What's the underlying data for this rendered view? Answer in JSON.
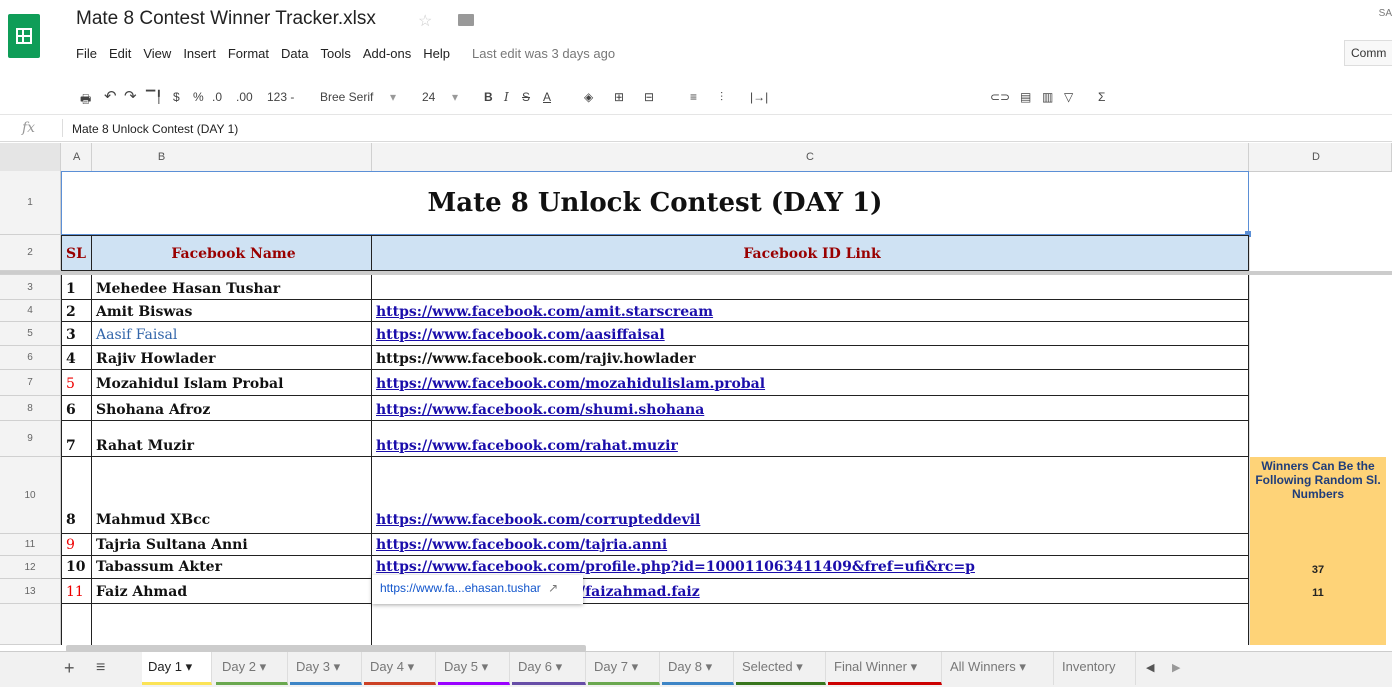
{
  "header": {
    "title": "Mate 8 Contest Winner Tracker.xlsx",
    "user_initials": "SA",
    "comments_label": "Comm"
  },
  "menu": {
    "items": [
      "File",
      "Edit",
      "View",
      "Insert",
      "Format",
      "Data",
      "Tools",
      "Add-ons",
      "Help"
    ],
    "last_edit": "Last edit was 3 days ago"
  },
  "toolbar": {
    "currency": "$",
    "percent": "%",
    "dec_less": ".0",
    "dec_more": ".00",
    "format_more": "123 -",
    "font": "Bree Serif",
    "font_size": "24"
  },
  "formula_bar": {
    "fx": "fx",
    "content": "Mate 8 Unlock Contest (DAY 1)"
  },
  "columns": [
    "A",
    "B",
    "C",
    "D"
  ],
  "row_numbers": [
    "1",
    "2",
    "3",
    "4",
    "5",
    "6",
    "7",
    "8",
    "9",
    "10",
    "11",
    "12",
    "13"
  ],
  "sheet": {
    "banner": "Mate 8 Unlock Contest (DAY 1)",
    "headers": {
      "sl": "SL",
      "name": "Facebook Name",
      "link": "Facebook ID Link"
    },
    "rows": [
      {
        "sl": "1",
        "name": "Mehedee Hasan Tushar",
        "link": ""
      },
      {
        "sl": "2",
        "name": "Amit Biswas",
        "link": "https://www.facebook.com/amit.starscream"
      },
      {
        "sl": "3",
        "name": "Aasif Faisal",
        "link": "https://www.facebook.com/aasiffaisal"
      },
      {
        "sl": "4",
        "name": "Rajiv Howlader",
        "link": "https://www.facebook.com/rajiv.howlader"
      },
      {
        "sl": "5",
        "name": "Mozahidul Islam Probal",
        "link": "https://www.facebook.com/mozahidulislam.probal"
      },
      {
        "sl": "6",
        "name": "Shohana Afroz",
        "link": "https://www.facebook.com/shumi.shohana"
      },
      {
        "sl": "7",
        "name": "Rahat Muzir",
        "link": "https://www.facebook.com/rahat.muzir"
      },
      {
        "sl": "8",
        "name": "Mahmud XBcc",
        "link": "https://www.facebook.com/corrupteddevil"
      },
      {
        "sl": "9",
        "name": "Tajria Sultana Anni",
        "link": "https://www.facebook.com/tajria.anni"
      },
      {
        "sl": "10",
        "name": "Tabassum Akter",
        "link": "https://www.facebook.com/profile.php?id=100011063411409&fref=ufi&rc=p"
      },
      {
        "sl": "11",
        "name": "Faiz Ahmad",
        "link": "https://www.facebook.com/faizahmad.faiz"
      }
    ],
    "winners_note": "Winners Can Be the Following Random Sl. Numbers",
    "winner_numbers": [
      "37",
      "11"
    ]
  },
  "tooltip": {
    "text": "https://www.fa...ehasan.tushar"
  },
  "tabs": [
    "Day 1",
    "Day 2",
    "Day 3",
    "Day 4",
    "Day 5",
    "Day 6",
    "Day 7",
    "Day 8",
    "Selected",
    "Final Winner",
    "All Winners",
    "Inventory"
  ],
  "colors": {
    "accent_green": "#0f9d58",
    "header_fill": "#cfe2f3",
    "header_text": "#990000",
    "winner_fill": "#fed378",
    "link": "#1a0dab"
  }
}
